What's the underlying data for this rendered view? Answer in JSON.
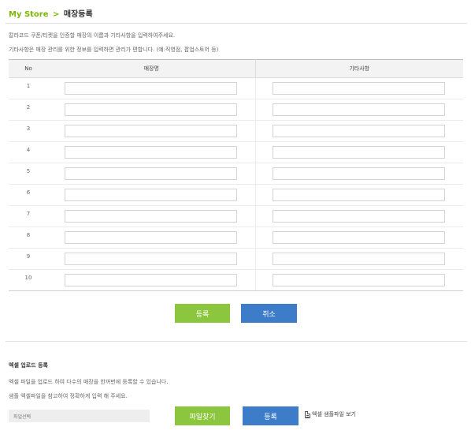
{
  "breadcrumb": {
    "store": "My Store",
    "separator": ">",
    "current": "매장등록"
  },
  "intro": {
    "line1": "칼라코드 쿠폰/티켓을 인증할 매장의 이름과 기타사항을 입력하여주세요.",
    "line2": "기타사항은 매장 관리를 위한 정보를 입력하면 관리가 편합니다. (예:직영점, 팝업스토어 등)"
  },
  "table": {
    "headers": {
      "no": "No",
      "name": "매장명",
      "etc": "기타사항"
    },
    "rows": [
      {
        "no": "1",
        "name": "",
        "etc": ""
      },
      {
        "no": "2",
        "name": "",
        "etc": ""
      },
      {
        "no": "3",
        "name": "",
        "etc": ""
      },
      {
        "no": "4",
        "name": "",
        "etc": ""
      },
      {
        "no": "5",
        "name": "",
        "etc": ""
      },
      {
        "no": "6",
        "name": "",
        "etc": ""
      },
      {
        "no": "7",
        "name": "",
        "etc": ""
      },
      {
        "no": "8",
        "name": "",
        "etc": ""
      },
      {
        "no": "9",
        "name": "",
        "etc": ""
      },
      {
        "no": "10",
        "name": "",
        "etc": ""
      }
    ]
  },
  "actions": {
    "register": "등록",
    "cancel": "취소"
  },
  "excel": {
    "title": "엑셀 업로드 등록",
    "line1": "엑셀 파일을 업로드 하여 다수의 매장을 한꺼번에 등록할 수 있습니다.",
    "line2": "샘플 엑셀파일을 참고하여 정확하게 입력 해 주세요.",
    "file_placeholder": "파일선택",
    "find_button": "파일찾기",
    "register_button": "등록",
    "sample_link": "엑셀 샘플파일 보기"
  },
  "colors": {
    "accent_green": "#8cc63f",
    "accent_blue": "#3d7cc9",
    "title_green": "#7ab800"
  }
}
